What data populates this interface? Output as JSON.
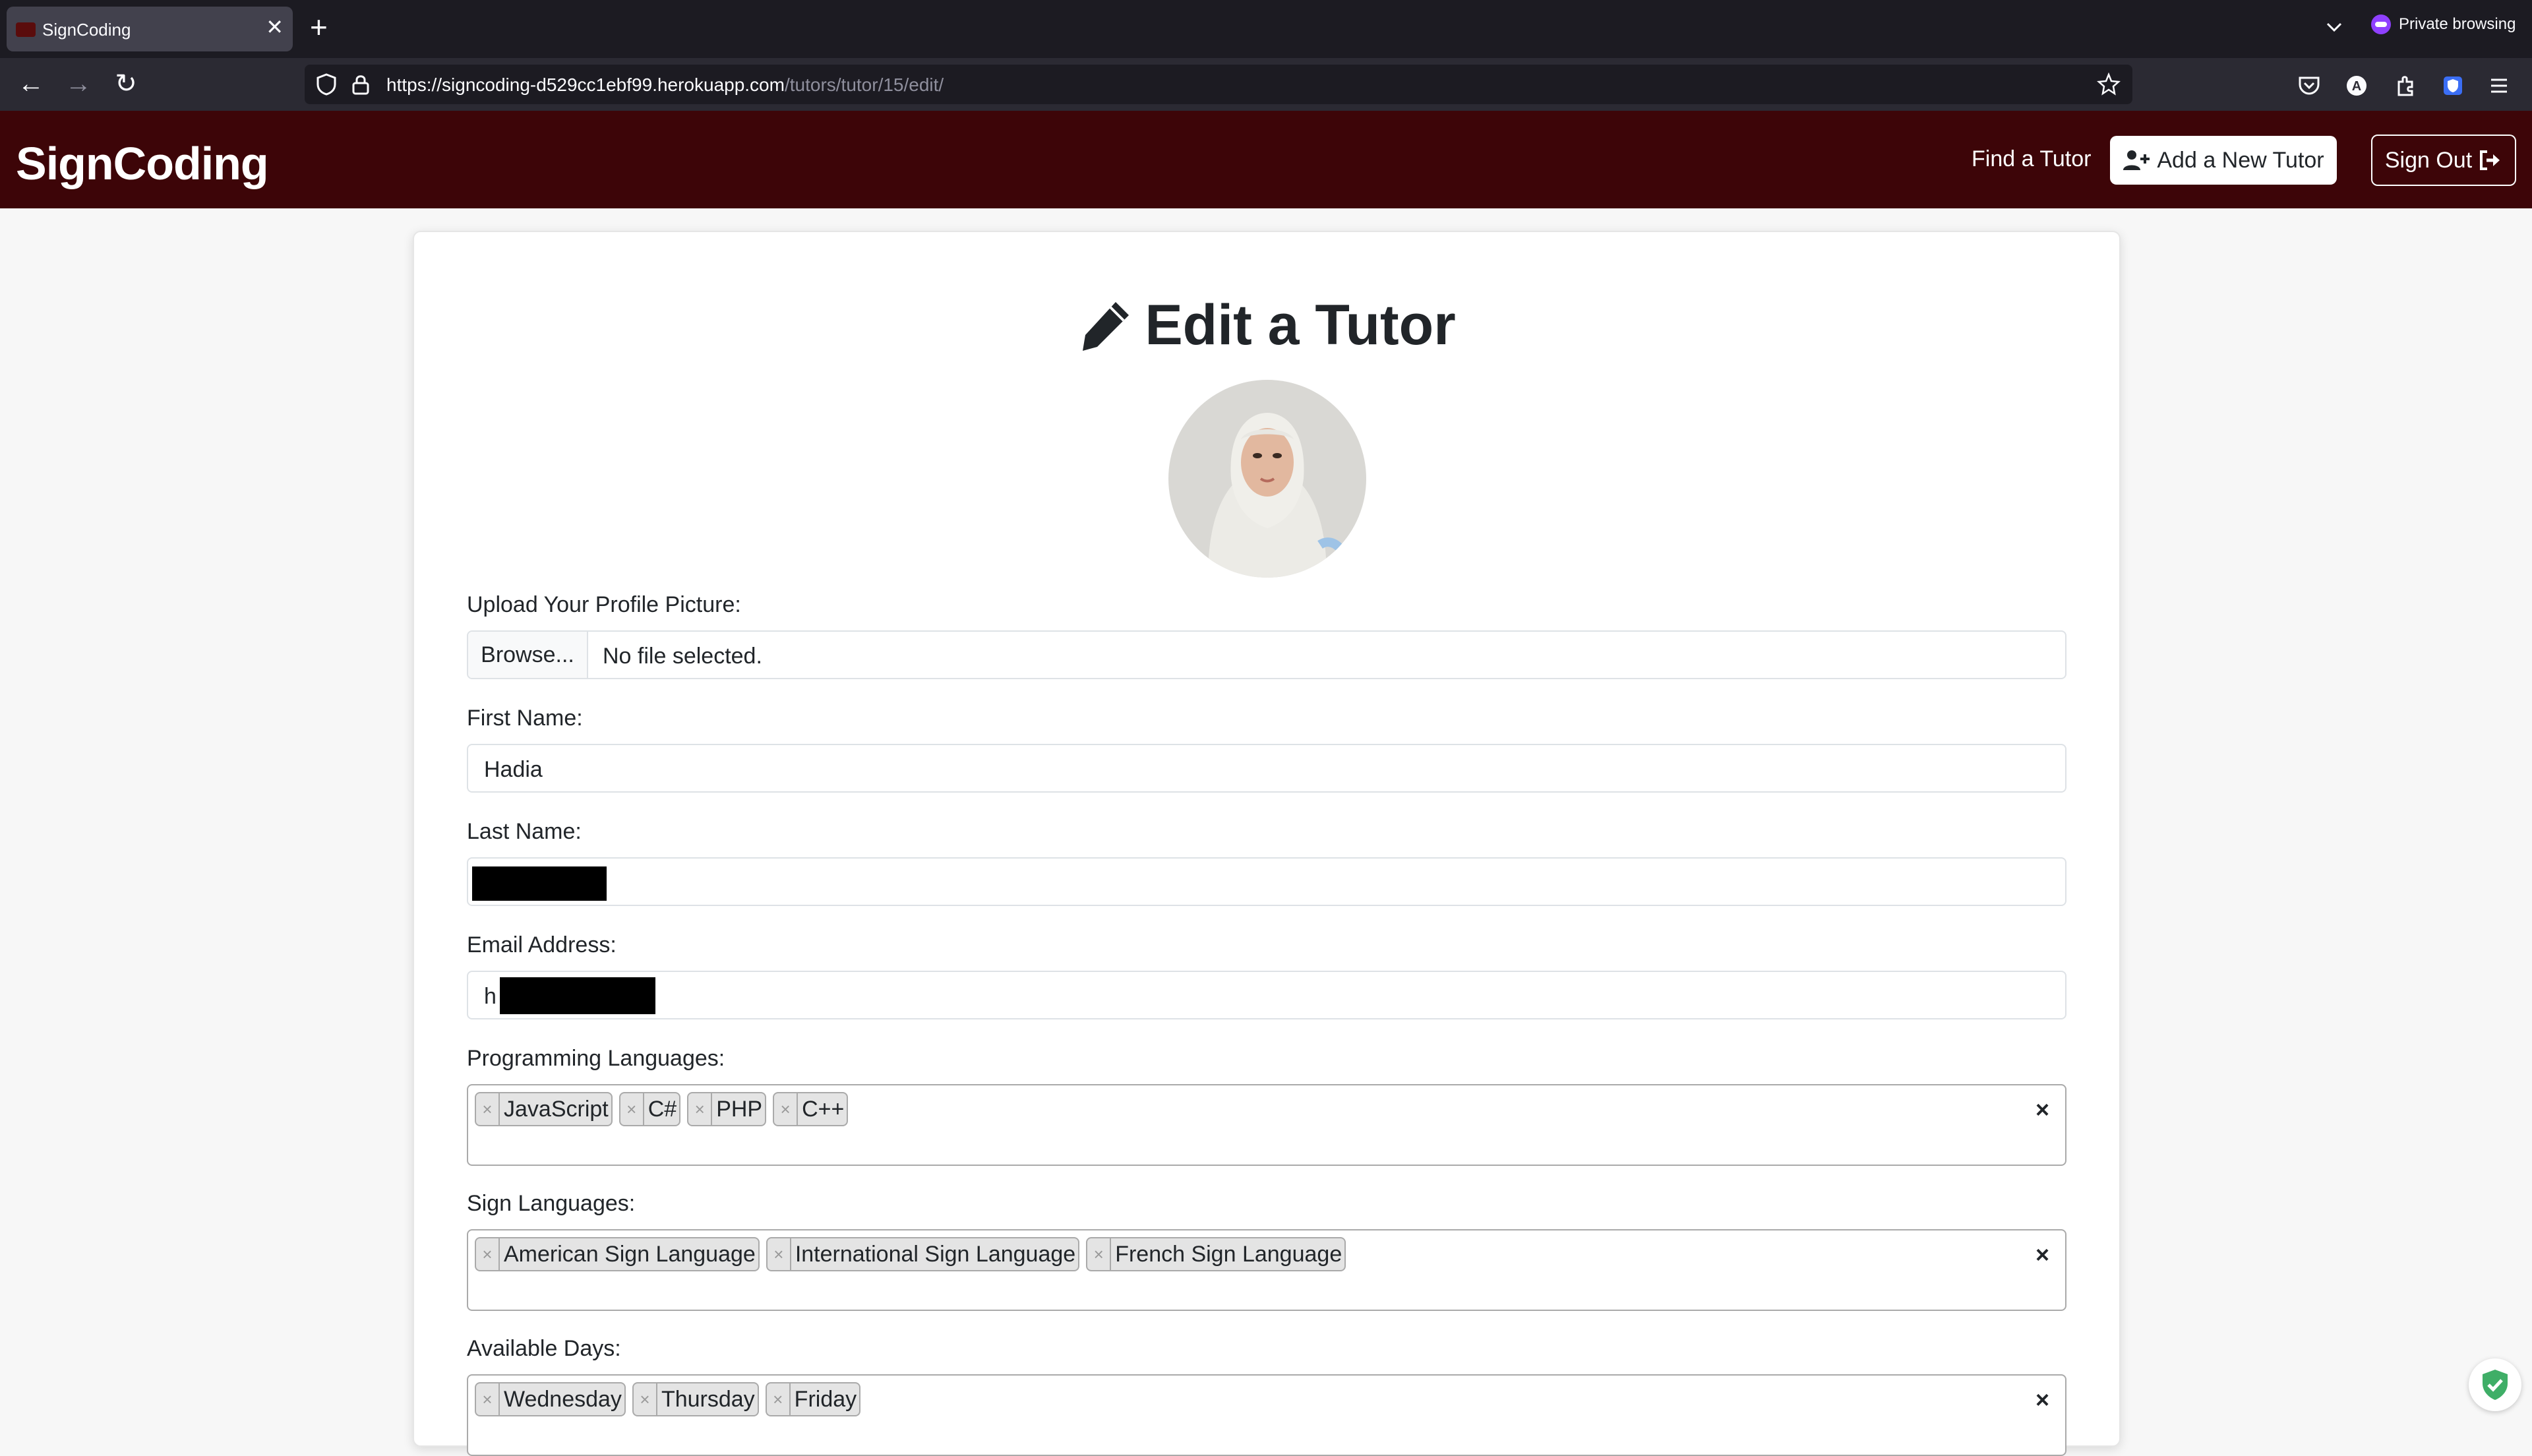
{
  "browser": {
    "tab_title": "SignCoding",
    "url_host": "https://signcoding-d529cc1ebf99.herokuapp.com",
    "url_path": "/tutors/tutor/15/edit/",
    "private_label": "Private browsing"
  },
  "navbar": {
    "brand": "SignCoding",
    "find_link": "Find a Tutor",
    "add_button": "Add a New Tutor",
    "signout_button": "Sign Out"
  },
  "form": {
    "title": "Edit a Tutor",
    "upload_label": "Upload Your Profile Picture:",
    "browse_label": "Browse...",
    "no_file": "No file selected.",
    "first_name_label": "First Name:",
    "first_name_value": "Hadia",
    "last_name_label": "Last Name:",
    "email_label": "Email Address:",
    "email_value_visible": "h",
    "programming_label": "Programming Languages:",
    "programming": [
      "JavaScript",
      "C#",
      "PHP",
      "C++"
    ],
    "sign_label": "Sign Languages:",
    "sign": [
      "American Sign Language",
      "International Sign Language",
      "French Sign Language"
    ],
    "days_label": "Available Days:",
    "days": [
      "Wednesday",
      "Thursday",
      "Friday"
    ],
    "chip_remove": "×",
    "clear_all": "×"
  },
  "colors": {
    "navbar": "#3d0508",
    "browser_dark": "#1c1b22"
  }
}
